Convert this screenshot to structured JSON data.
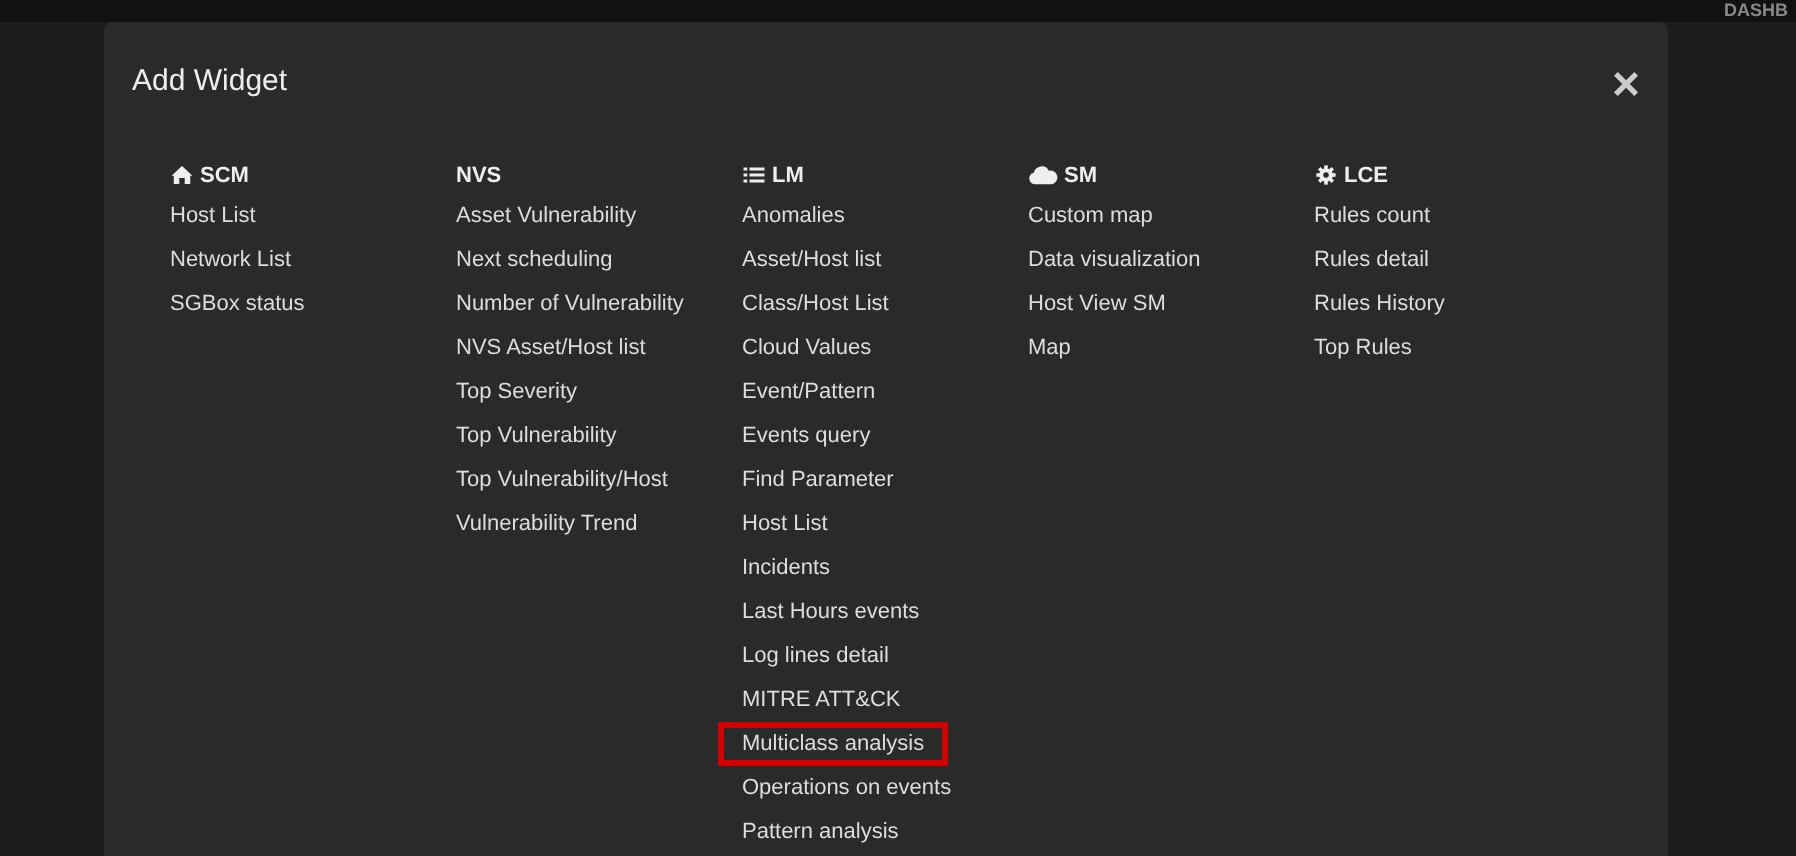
{
  "top_bar": {
    "label": "DASHB"
  },
  "dialog": {
    "title": "Add Widget",
    "close": "×"
  },
  "columns": [
    {
      "title": "SCM",
      "kind": "home",
      "items": [
        {
          "label": "Host List",
          "highlighted": false
        },
        {
          "label": "Network List",
          "highlighted": false
        },
        {
          "label": "SGBox status",
          "highlighted": false
        }
      ]
    },
    {
      "title": "NVS",
      "items": [
        {
          "label": "Asset Vulnerability",
          "highlighted": false
        },
        {
          "label": "Next scheduling",
          "highlighted": false
        },
        {
          "label": "Number of Vulnerability",
          "highlighted": false
        },
        {
          "label": "NVS Asset/Host list",
          "highlighted": false
        },
        {
          "label": "Top Severity",
          "highlighted": false
        },
        {
          "label": "Top Vulnerability",
          "highlighted": false
        },
        {
          "label": "Top Vulnerability/Host",
          "highlighted": false
        },
        {
          "label": "Vulnerability Trend",
          "highlighted": false
        }
      ]
    },
    {
      "title": "LM",
      "kind": "list",
      "items": [
        {
          "label": "Anomalies",
          "highlighted": false
        },
        {
          "label": "Asset/Host list",
          "highlighted": false
        },
        {
          "label": "Class/Host List",
          "highlighted": false
        },
        {
          "label": "Cloud Values",
          "highlighted": false
        },
        {
          "label": "Event/Pattern",
          "highlighted": false
        },
        {
          "label": "Events query",
          "highlighted": false
        },
        {
          "label": "Find Parameter",
          "highlighted": false
        },
        {
          "label": "Host List",
          "highlighted": false
        },
        {
          "label": "Incidents",
          "highlighted": false
        },
        {
          "label": "Last Hours events",
          "highlighted": false
        },
        {
          "label": "Log lines detail",
          "highlighted": false
        },
        {
          "label": "MITRE ATT&CK",
          "highlighted": false
        },
        {
          "label": "Multiclass analysis",
          "highlighted": true
        },
        {
          "label": "Operations on events",
          "highlighted": false
        },
        {
          "label": "Pattern analysis",
          "highlighted": false
        }
      ]
    },
    {
      "title": "SM",
      "kind": "cloud",
      "items": [
        {
          "label": "Custom map",
          "highlighted": false
        },
        {
          "label": "Data visualization",
          "highlighted": false
        },
        {
          "label": "Host View SM",
          "highlighted": false
        },
        {
          "label": "Map",
          "highlighted": false
        }
      ]
    },
    {
      "title": "LCE",
      "kind": "gear",
      "items": [
        {
          "label": "Rules count",
          "highlighted": false
        },
        {
          "label": "Rules detail",
          "highlighted": false
        },
        {
          "label": "Rules History",
          "highlighted": false
        },
        {
          "label": "Top Rules",
          "highlighted": false
        }
      ]
    }
  ]
}
